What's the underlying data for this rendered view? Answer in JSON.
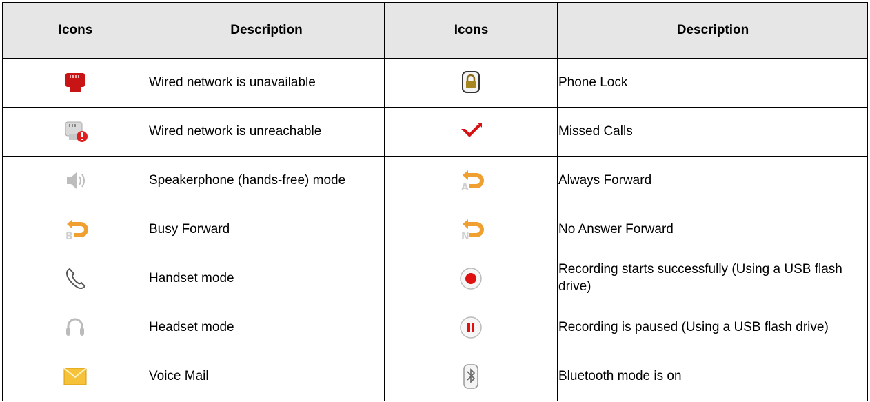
{
  "headers": [
    "Icons",
    "Description",
    "Icons",
    "Description"
  ],
  "rows": [
    {
      "left": {
        "icon": "wired-network-unavailable-icon",
        "description": "Wired network is unavailable"
      },
      "right": {
        "icon": "phone-lock-icon",
        "description": "Phone Lock"
      }
    },
    {
      "left": {
        "icon": "wired-network-unreachable-icon",
        "description": "Wired network is unreachable"
      },
      "right": {
        "icon": "missed-calls-icon",
        "description": "Missed Calls"
      }
    },
    {
      "left": {
        "icon": "speakerphone-icon",
        "description": "Speakerphone (hands-free) mode"
      },
      "right": {
        "icon": "always-forward-icon",
        "description": "Always Forward"
      }
    },
    {
      "left": {
        "icon": "busy-forward-icon",
        "description": "Busy Forward"
      },
      "right": {
        "icon": "no-answer-forward-icon",
        "description": "No Answer Forward"
      }
    },
    {
      "left": {
        "icon": "handset-icon",
        "description": "Handset mode"
      },
      "right": {
        "icon": "recording-icon",
        "description": "Recording starts successfully (Using a USB flash drive)"
      }
    },
    {
      "left": {
        "icon": "headset-icon",
        "description": "Headset mode"
      },
      "right": {
        "icon": "recording-paused-icon",
        "description": "Recording is paused (Using a USB flash drive)"
      }
    },
    {
      "left": {
        "icon": "voice-mail-icon",
        "description": "Voice Mail"
      },
      "right": {
        "icon": "bluetooth-icon",
        "description": "Bluetooth mode is on"
      }
    }
  ],
  "colors": {
    "header_bg": "#e6e6e6",
    "forward_orange": "#f0a030",
    "red": "#e02020"
  }
}
